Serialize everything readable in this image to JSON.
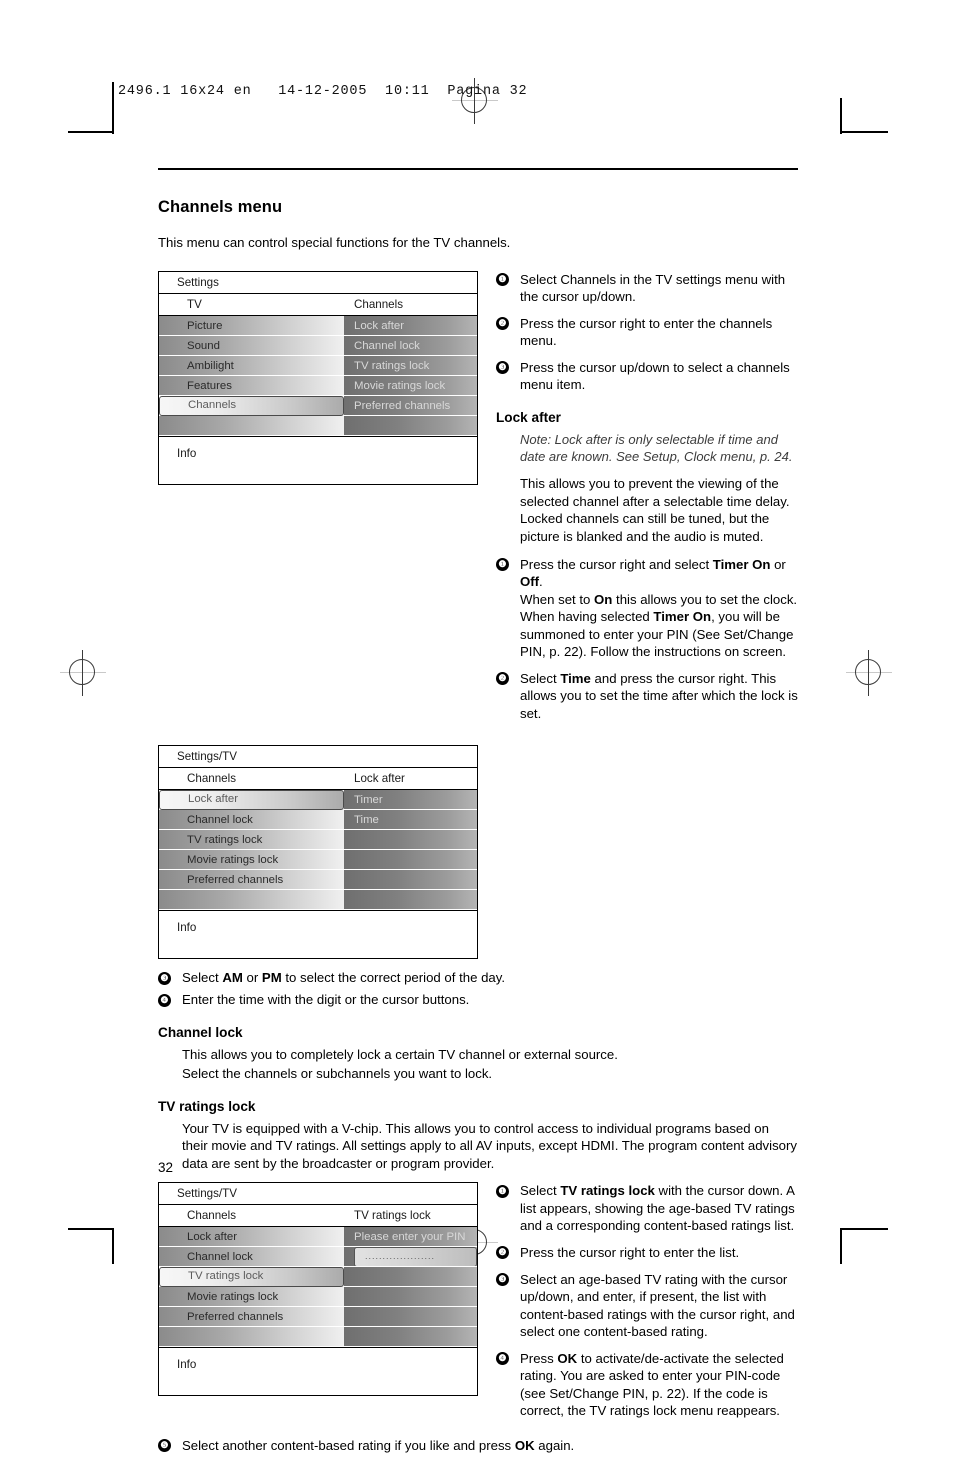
{
  "prepress": {
    "slug": "2496.1 16x24 en   14-12-2005  10:11  Pagina 32"
  },
  "page": {
    "title": "Channels menu",
    "intro": "This menu can control special functions for the TV channels.",
    "number": "32"
  },
  "menu1": {
    "title": "Settings",
    "left_header": "TV",
    "right_header": "Channels",
    "left_items": [
      "Picture",
      "Sound",
      "Ambilight",
      "Features",
      "Channels",
      ""
    ],
    "left_selected_index": 4,
    "right_items": [
      "Lock after",
      "Channel lock",
      "TV ratings lock",
      "Movie ratings lock",
      "Preferred channels",
      ""
    ],
    "info_label": "Info"
  },
  "menu2": {
    "title": "Settings/TV",
    "left_header": "Channels",
    "right_header": "Lock after",
    "left_items": [
      "Lock after",
      "Channel lock",
      "TV ratings lock",
      "Movie ratings lock",
      "Preferred channels",
      ""
    ],
    "left_selected_index": 0,
    "right_items": [
      "Timer",
      "Time",
      "",
      "",
      "",
      ""
    ],
    "info_label": "Info"
  },
  "menu3": {
    "title": "Settings/TV",
    "left_header": "Channels",
    "right_header": "TV ratings lock",
    "left_items": [
      "Lock after",
      "Channel lock",
      "TV ratings lock",
      "Movie ratings lock",
      "Preferred channels",
      ""
    ],
    "left_selected_index": 2,
    "right_items": [
      "Please enter your PIN",
      "",
      "",
      "",
      ""
    ],
    "pin_placeholder": "....................",
    "info_label": "Info"
  },
  "steps_channels": [
    "Select Channels in the TV settings menu with the cursor up/down.",
    "Press the cursor right to enter the channels menu.",
    "Press the cursor up/down to select a channels menu item."
  ],
  "lock_after": {
    "heading": "Lock after",
    "note": "Note: Lock after is only selectable if time and date are known. See Setup, Clock menu, p. 24.",
    "body": "This allows you to prevent the viewing of the selected channel after a selectable time delay. Locked channels can still be tuned, but the picture is blanked and the audio is muted.",
    "step1_a": "Press the cursor right and select ",
    "step1_b1": "Timer On",
    "step1_c": " or ",
    "step1_b2": "Off",
    "step1_d": ".",
    "step1_line2_a": "When set to ",
    "step1_line2_b": "On",
    "step1_line2_c": " this allows you to set the clock.",
    "step1_line3_a": "When having selected ",
    "step1_line3_b": "Timer On",
    "step1_line3_c": ", you will be summoned to enter your PIN (See Set/Change PIN, p. 22). Follow the instructions on screen.",
    "step2_a": "Select ",
    "step2_b": "Time",
    "step2_c": " and press the cursor right. This allows you to set the time after which the lock is set.",
    "step3_a": "Select ",
    "step3_b1": "AM",
    "step3_c": " or ",
    "step3_b2": "PM",
    "step3_d": " to select the correct period of the day.",
    "step4": "Enter the time with the digit or the cursor buttons."
  },
  "channel_lock": {
    "heading": "Channel lock",
    "body_line1": "This allows you to completely lock a certain TV channel or external source.",
    "body_line2": "Select the channels or subchannels you want to lock."
  },
  "tv_ratings_lock": {
    "heading": "TV ratings lock",
    "body": "Your TV is equipped with a V-chip. This allows you to control access to individual programs based on their movie and TV ratings. All settings apply to all AV inputs, except HDMI. The program content advisory data are sent by the broadcaster or program provider.",
    "step1_a": "Select ",
    "step1_b": "TV ratings lock",
    "step1_c": " with the cursor down. A list appears, showing the age-based TV ratings and a corresponding content-based ratings list.",
    "step2": "Press the cursor right to enter the list.",
    "step3": "Select an age-based TV rating with the cursor up/down, and enter, if present, the list with content-based ratings with the cursor right, and select one content-based rating.",
    "step4_a": "Press ",
    "step4_b": "OK",
    "step4_c": " to activate/de-activate the selected rating. You are asked to enter your PIN-code (see Set/Change PIN, p. 22). If the code is correct, the TV ratings lock menu reappears.",
    "step5_a": "Select another content-based rating if you like and press ",
    "step5_b": "OK",
    "step5_c": " again."
  },
  "bullets": {
    "b1": "❶",
    "b2": "❷",
    "b3": "❸",
    "b4": "❹",
    "b5": "❺"
  }
}
